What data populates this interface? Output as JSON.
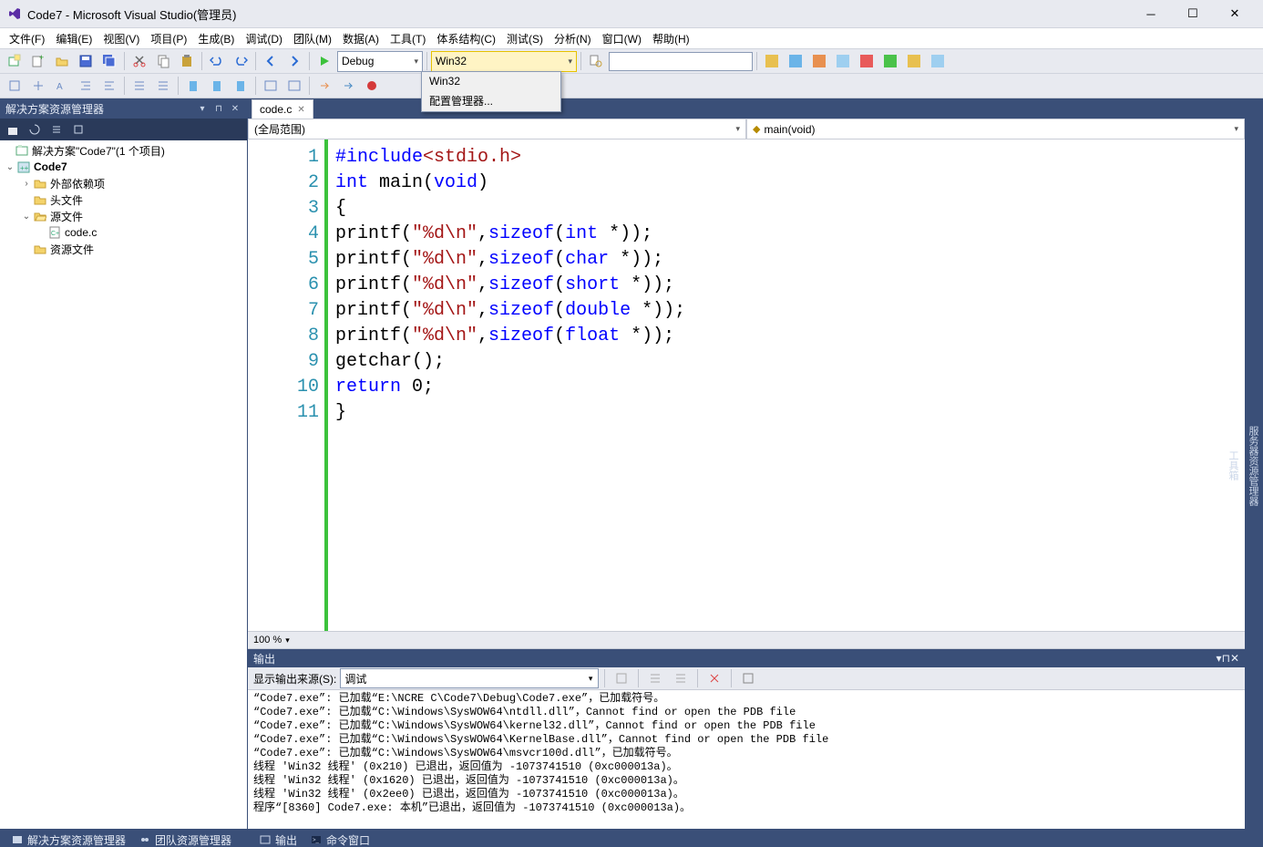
{
  "title": "Code7 - Microsoft Visual Studio(管理员)",
  "menu": [
    "文件(F)",
    "编辑(E)",
    "视图(V)",
    "项目(P)",
    "生成(B)",
    "调试(D)",
    "团队(M)",
    "数据(A)",
    "工具(T)",
    "体系结构(C)",
    "测试(S)",
    "分析(N)",
    "窗口(W)",
    "帮助(H)"
  ],
  "toolbar": {
    "debug_label": "Debug",
    "platform_label": "Win32",
    "platform_options": [
      "Win32",
      "配置管理器..."
    ]
  },
  "solution_explorer": {
    "title": "解决方案资源管理器",
    "solution_label": "解决方案\"Code7\"(1 个项目)",
    "project": "Code7",
    "ext_deps": "外部依赖项",
    "headers": "头文件",
    "sources": "源文件",
    "source_file": "code.c",
    "resources": "资源文件"
  },
  "editor": {
    "tab": "code.c",
    "scope": "(全局范围)",
    "member": "main(void)",
    "zoom": "100 %",
    "code_lines": [
      {
        "n": 1,
        "tokens": [
          {
            "t": "#include",
            "c": "pp"
          },
          {
            "t": "<stdio.h>",
            "c": "inc"
          }
        ]
      },
      {
        "n": 2,
        "tokens": [
          {
            "t": "int",
            "c": "kw"
          },
          {
            "t": " main(",
            "c": "fn"
          },
          {
            "t": "void",
            "c": "kw"
          },
          {
            "t": ")",
            "c": "fn"
          }
        ]
      },
      {
        "n": 3,
        "tokens": [
          {
            "t": "{",
            "c": "fn"
          }
        ]
      },
      {
        "n": 4,
        "tokens": [
          {
            "t": "printf(",
            "c": "fn"
          },
          {
            "t": "\"%d\\n\"",
            "c": "str"
          },
          {
            "t": ",",
            "c": "fn"
          },
          {
            "t": "sizeof",
            "c": "kw"
          },
          {
            "t": "(",
            "c": "fn"
          },
          {
            "t": "int",
            "c": "kw"
          },
          {
            "t": " *));",
            "c": "fn"
          }
        ]
      },
      {
        "n": 5,
        "tokens": [
          {
            "t": "printf(",
            "c": "fn"
          },
          {
            "t": "\"%d\\n\"",
            "c": "str"
          },
          {
            "t": ",",
            "c": "fn"
          },
          {
            "t": "sizeof",
            "c": "kw"
          },
          {
            "t": "(",
            "c": "fn"
          },
          {
            "t": "char",
            "c": "kw"
          },
          {
            "t": " *));",
            "c": "fn"
          }
        ]
      },
      {
        "n": 6,
        "tokens": [
          {
            "t": "printf(",
            "c": "fn"
          },
          {
            "t": "\"%d\\n\"",
            "c": "str"
          },
          {
            "t": ",",
            "c": "fn"
          },
          {
            "t": "sizeof",
            "c": "kw"
          },
          {
            "t": "(",
            "c": "fn"
          },
          {
            "t": "short",
            "c": "kw"
          },
          {
            "t": " *));",
            "c": "fn"
          }
        ]
      },
      {
        "n": 7,
        "tokens": [
          {
            "t": "printf(",
            "c": "fn"
          },
          {
            "t": "\"%d\\n\"",
            "c": "str"
          },
          {
            "t": ",",
            "c": "fn"
          },
          {
            "t": "sizeof",
            "c": "kw"
          },
          {
            "t": "(",
            "c": "fn"
          },
          {
            "t": "double",
            "c": "kw"
          },
          {
            "t": " *));",
            "c": "fn"
          }
        ]
      },
      {
        "n": 8,
        "tokens": [
          {
            "t": "printf(",
            "c": "fn"
          },
          {
            "t": "\"%d\\n\"",
            "c": "str"
          },
          {
            "t": ",",
            "c": "fn"
          },
          {
            "t": "sizeof",
            "c": "kw"
          },
          {
            "t": "(",
            "c": "fn"
          },
          {
            "t": "float",
            "c": "kw"
          },
          {
            "t": " *));",
            "c": "fn"
          }
        ]
      },
      {
        "n": 9,
        "tokens": [
          {
            "t": "getchar();",
            "c": "fn"
          }
        ]
      },
      {
        "n": 10,
        "tokens": [
          {
            "t": "return",
            "c": "kw"
          },
          {
            "t": " 0;",
            "c": "fn"
          }
        ]
      },
      {
        "n": 11,
        "tokens": [
          {
            "t": "}",
            "c": "fn"
          }
        ]
      }
    ]
  },
  "output": {
    "title": "输出",
    "source_label": "显示输出来源(S):",
    "source_value": "调试",
    "lines": [
      "“Code7.exe”: 已加载“E:\\NCRE C\\Code7\\Debug\\Code7.exe”，已加载符号。",
      "“Code7.exe”: 已加载“C:\\Windows\\SysWOW64\\ntdll.dll”，Cannot find or open the PDB file",
      "“Code7.exe”: 已加载“C:\\Windows\\SysWOW64\\kernel32.dll”，Cannot find or open the PDB file",
      "“Code7.exe”: 已加载“C:\\Windows\\SysWOW64\\KernelBase.dll”，Cannot find or open the PDB file",
      "“Code7.exe”: 已加载“C:\\Windows\\SysWOW64\\msvcr100d.dll”，已加载符号。",
      "线程 'Win32 线程' (0x210) 已退出，返回值为 -1073741510 (0xc000013a)。",
      "线程 'Win32 线程' (0x1620) 已退出，返回值为 -1073741510 (0xc000013a)。",
      "线程 'Win32 线程' (0x2ee0) 已退出，返回值为 -1073741510 (0xc000013a)。",
      "程序“[8360] Code7.exe: 本机”已退出，返回值为 -1073741510 (0xc000013a)。"
    ]
  },
  "statusbar": {
    "sln_explorer": "解决方案资源管理器",
    "team_explorer": "团队资源管理器",
    "output_tab": "输出",
    "command_window": "命令窗口"
  },
  "rightbar": {
    "server_explorer": "服务器资源管理器",
    "toolbox": "工具箱"
  }
}
